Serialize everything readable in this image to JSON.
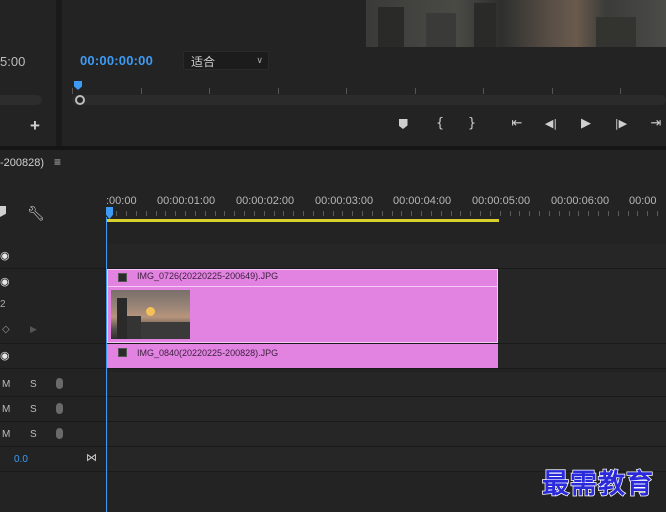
{
  "source_monitor": {
    "timecode": "5:00",
    "add_label": "+"
  },
  "program_monitor": {
    "timecode": "00:00:00:00",
    "zoom_select": "适合"
  },
  "transport": {
    "marker": "marker-icon",
    "mark_in": "{",
    "mark_out": "}",
    "go_to_in": "⇤",
    "step_back": "◀|",
    "play": "▶",
    "step_forward": "|▶",
    "go_to_out": "⇥"
  },
  "timeline": {
    "sequence_name": "-200828)",
    "menu_icon": "≡",
    "ruler_labels": [
      ":00:00",
      "00:00:01:00",
      "00:00:02:00",
      "00:00:03:00",
      "00:00:04:00",
      "00:00:05:00",
      "00:00:06:00",
      "00:00"
    ],
    "track_label_v2": "2",
    "audio_tracks": [
      {
        "m": "M",
        "s": "S"
      },
      {
        "m": "M",
        "s": "S"
      },
      {
        "m": "M",
        "s": "S"
      }
    ],
    "master_value": "0.0",
    "clips": {
      "upper": "IMG_0726(20220225-200649).JPG",
      "lower": "IMG_0840(20220225-200828).JPG"
    }
  },
  "watermark": "最需教育"
}
